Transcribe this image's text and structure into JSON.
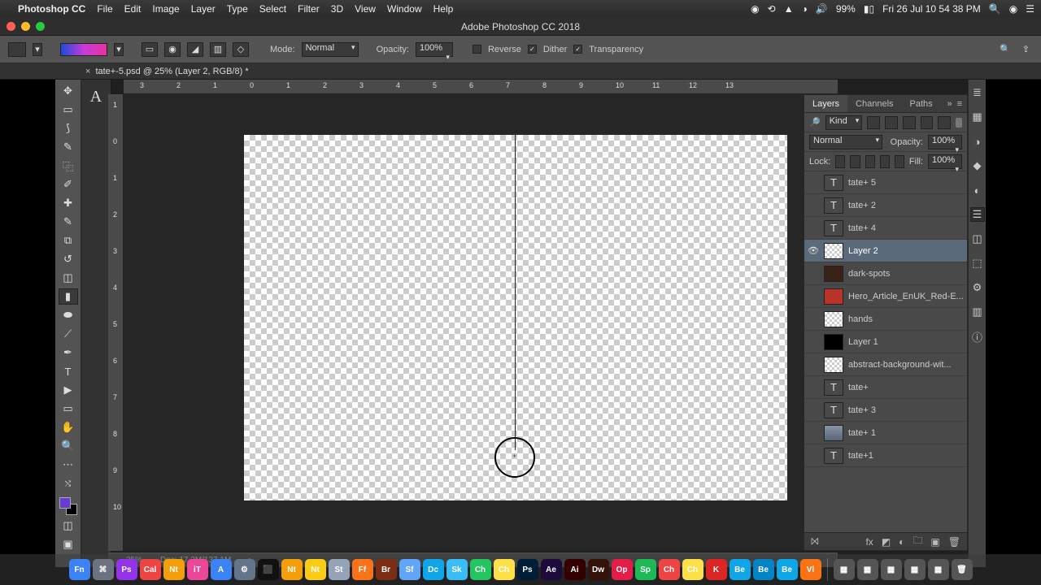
{
  "menubar": {
    "app": "Photoshop CC",
    "items": [
      "File",
      "Edit",
      "Image",
      "Layer",
      "Type",
      "Select",
      "Filter",
      "3D",
      "View",
      "Window",
      "Help"
    ],
    "status": {
      "battery_pct": "99%",
      "datetime": "Fri 26 Jul  10 54 38 PM"
    }
  },
  "window": {
    "title": "Adobe Photoshop CC 2018"
  },
  "doc_tab": "tate+-5.psd @ 25% (Layer 2, RGB/8) *",
  "options": {
    "mode_label": "Mode:",
    "mode_value": "Normal",
    "opacity_label": "Opacity:",
    "opacity_value": "100%",
    "dither_label": "Dither",
    "dither_on": true,
    "reverse_label": "Reverse",
    "reverse_on": false,
    "transparency_label": "Transparency",
    "transparency_on": true
  },
  "ruler_h": [
    "3",
    "2",
    "1",
    "0",
    "1",
    "2",
    "3",
    "4",
    "5",
    "6",
    "7",
    "8",
    "9",
    "10",
    "11",
    "12",
    "13"
  ],
  "ruler_v": [
    "1",
    "0",
    "1",
    "2",
    "3",
    "4",
    "5",
    "6",
    "7",
    "8",
    "9",
    "10"
  ],
  "status": {
    "zoom": "25%",
    "doc": "Doc: 17.2M/137.1M"
  },
  "panel": {
    "tabs": [
      "Layers",
      "Channels",
      "Paths"
    ],
    "filter_label": "Kind",
    "blend_mode": "Normal",
    "opacity_label": "Opacity:",
    "opacity_value": "100%",
    "lock_label": "Lock:",
    "fill_label": "Fill:",
    "fill_value": "100%",
    "layers": [
      {
        "name": "tate+ 5",
        "thumb": "T",
        "visible": false
      },
      {
        "name": "tate+ 2",
        "thumb": "T",
        "visible": false
      },
      {
        "name": "tate+ 4",
        "thumb": "T",
        "visible": false
      },
      {
        "name": "Layer 2",
        "thumb": "check",
        "visible": true,
        "selected": true
      },
      {
        "name": "dark-spots",
        "thumb": "dark",
        "visible": false
      },
      {
        "name": "Hero_Article_EnUK_Red-E...",
        "thumb": "red",
        "visible": false
      },
      {
        "name": "hands",
        "thumb": "check",
        "visible": false
      },
      {
        "name": "Layer 1",
        "thumb": "black",
        "visible": false
      },
      {
        "name": "abstract-background-wit...",
        "thumb": "check",
        "visible": false
      },
      {
        "name": "tate+",
        "thumb": "T",
        "visible": false
      },
      {
        "name": "tate+ 3",
        "thumb": "T",
        "visible": false
      },
      {
        "name": "tate+ 1",
        "thumb": "img",
        "visible": false
      },
      {
        "name": "tate+1",
        "thumb": "T",
        "visible": false
      }
    ]
  },
  "dock": [
    "Fn",
    "⌘",
    "Ps",
    "Cal",
    "Nt",
    "iT",
    "A",
    "⚙",
    "⬛",
    "Nt",
    "Nt",
    "St",
    "Ff",
    "Br",
    "Sf",
    "Dc",
    "Sk",
    "Ch",
    "Ch",
    "Ps",
    "Ae",
    "Ai",
    "Dw",
    "Op",
    "Sp",
    "Ch",
    "Ch",
    "K",
    "Be",
    "Be",
    "Be",
    "Vl"
  ],
  "dock_right": [
    "▦",
    "▦",
    "▦",
    "▦",
    "▦",
    "🗑"
  ]
}
